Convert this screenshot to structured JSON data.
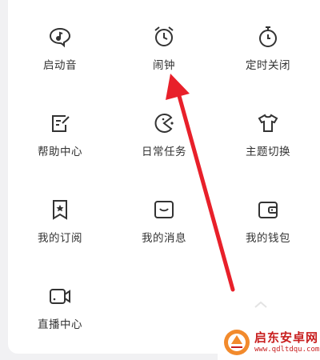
{
  "menu": {
    "items": [
      {
        "label": "启动音",
        "icon": "music-note-icon"
      },
      {
        "label": "闹钟",
        "icon": "alarm-clock-icon"
      },
      {
        "label": "定时关闭",
        "icon": "timer-icon"
      },
      {
        "label": "帮助中心",
        "icon": "help-edit-icon"
      },
      {
        "label": "日常任务",
        "icon": "pacman-task-icon"
      },
      {
        "label": "主题切换",
        "icon": "tshirt-icon"
      },
      {
        "label": "我的订阅",
        "icon": "bookmark-icon"
      },
      {
        "label": "我的消息",
        "icon": "message-icon"
      },
      {
        "label": "我的钱包",
        "icon": "wallet-icon"
      },
      {
        "label": "直播中心",
        "icon": "video-camera-icon"
      }
    ]
  },
  "watermark": {
    "title": "启东安卓网",
    "url": "www.qdltdqu.com"
  },
  "colors": {
    "arrow": "#e8202a",
    "icon": "#333333",
    "watermark": "#c81e1e"
  }
}
